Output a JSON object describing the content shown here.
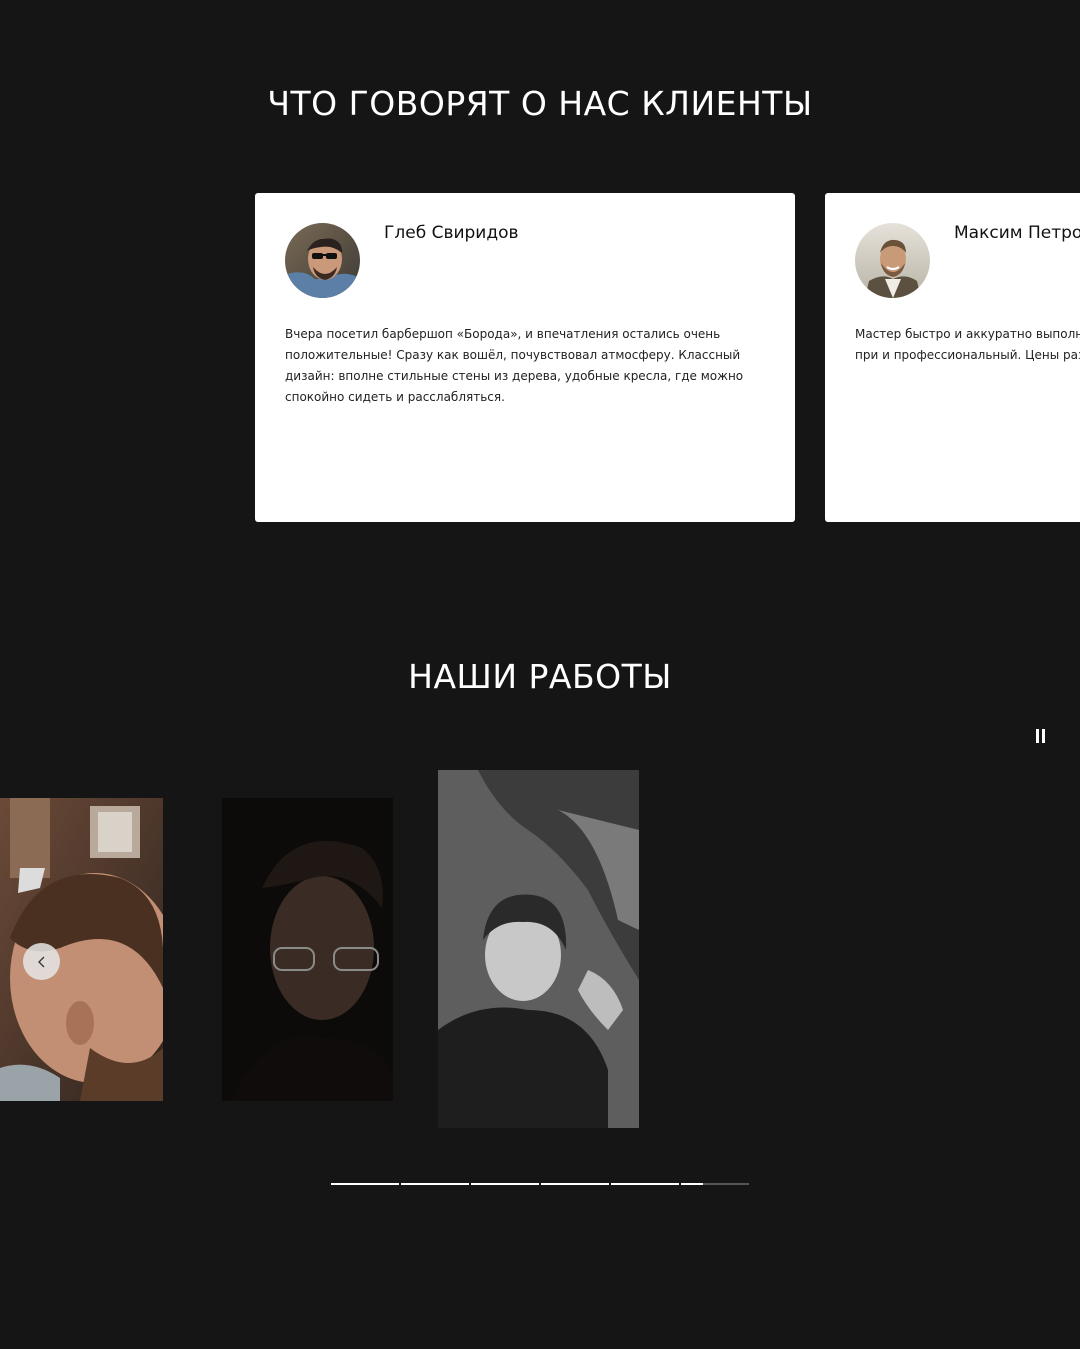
{
  "reviews": {
    "title": "ЧТО ГОВОРЯТ О НАС КЛИЕНТЫ",
    "cards": [
      {
        "name": "Глеб Свиридов",
        "avatar_icon": "avatar-man-sunglasses",
        "text": "Вчера посетил барбершоп «Борода», и впечатления остались очень положительные! Сразу как вошёл, почувствовал атмосферу. Классный дизайн: вполне стильные стены из дерева, удобные кресла, где можно спокойно сидеть и расслабляться."
      },
      {
        "name": "Максим Петро",
        "avatar_icon": "avatar-smiling-man-plaid",
        "text": "Мастер быстро и аккуратно выполнил ст по укладке. Атмосфера в заведении при и профессиональный. Цены разумные д снова!"
      }
    ]
  },
  "works": {
    "title": "НАШИ РАБОТЫ",
    "pause_icon": "pause-icon",
    "prev_icon": "chevron-left-icon",
    "photos": [
      {
        "icon": "haircut-side-fade-photo"
      },
      {
        "icon": "man-glasses-dark-photo"
      },
      {
        "icon": "boy-haircut-bw-photo"
      }
    ],
    "progress": {
      "segments": 6,
      "completed": 5,
      "current_fraction": 0.33
    }
  },
  "colors": {
    "background": "#151515",
    "card": "#ffffff",
    "text_dark": "#1a1a1a",
    "progress_track": "#555555",
    "progress_fill": "#ffffff"
  }
}
